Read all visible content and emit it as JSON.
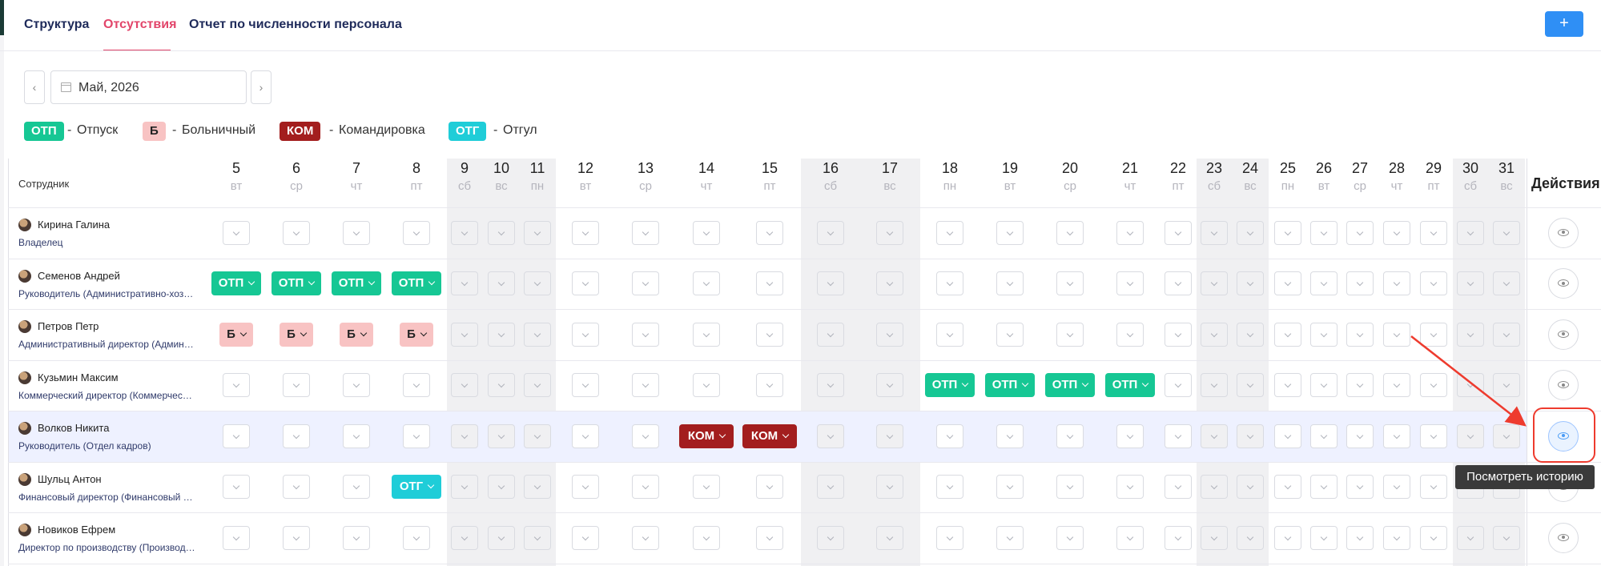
{
  "tabs": [
    {
      "label": "Структура",
      "active": false
    },
    {
      "label": "Отсутствия",
      "active": true
    },
    {
      "label": "Отчет по численности персонала",
      "active": false
    }
  ],
  "add_button": {
    "label": "+"
  },
  "month_picker": {
    "value": "Май, 2026",
    "prev": "‹",
    "next": "›"
  },
  "legend": [
    {
      "code": "ОТП",
      "label": "Отпуск",
      "kind": "otp"
    },
    {
      "code": "Б",
      "label": "Больничный",
      "kind": "b"
    },
    {
      "code": "КОМ",
      "label": "Командировка",
      "kind": "kom"
    },
    {
      "code": "ОТГ",
      "label": "Отгул",
      "kind": "otg"
    }
  ],
  "legend_separator": "-",
  "columns": {
    "employee": "Сотрудник",
    "actions": "Действия"
  },
  "days": [
    {
      "d": "5",
      "w": "вт",
      "weekend": false
    },
    {
      "d": "6",
      "w": "ср",
      "weekend": false
    },
    {
      "d": "7",
      "w": "чт",
      "weekend": false
    },
    {
      "d": "8",
      "w": "пт",
      "weekend": false
    },
    {
      "d": "9",
      "w": "сб",
      "weekend": true
    },
    {
      "d": "10",
      "w": "вс",
      "weekend": true
    },
    {
      "d": "11",
      "w": "пн",
      "weekend": true
    },
    {
      "d": "12",
      "w": "вт",
      "weekend": false
    },
    {
      "d": "13",
      "w": "ср",
      "weekend": false
    },
    {
      "d": "14",
      "w": "чт",
      "weekend": false
    },
    {
      "d": "15",
      "w": "пт",
      "weekend": false
    },
    {
      "d": "16",
      "w": "сб",
      "weekend": true
    },
    {
      "d": "17",
      "w": "вс",
      "weekend": true
    },
    {
      "d": "18",
      "w": "пн",
      "weekend": false
    },
    {
      "d": "19",
      "w": "вт",
      "weekend": false
    },
    {
      "d": "20",
      "w": "ср",
      "weekend": false
    },
    {
      "d": "21",
      "w": "чт",
      "weekend": false
    },
    {
      "d": "22",
      "w": "пт",
      "weekend": false
    },
    {
      "d": "23",
      "w": "сб",
      "weekend": true
    },
    {
      "d": "24",
      "w": "вс",
      "weekend": true
    },
    {
      "d": "25",
      "w": "пн",
      "weekend": false
    },
    {
      "d": "26",
      "w": "вт",
      "weekend": false
    },
    {
      "d": "27",
      "w": "ср",
      "weekend": false
    },
    {
      "d": "28",
      "w": "чт",
      "weekend": false
    },
    {
      "d": "29",
      "w": "пт",
      "weekend": false
    },
    {
      "d": "30",
      "w": "сб",
      "weekend": true
    },
    {
      "d": "31",
      "w": "вс",
      "weekend": true
    }
  ],
  "employees": [
    {
      "name": "Кирина Галина",
      "role": "Владелец",
      "absences": {}
    },
    {
      "name": "Семенов Андрей",
      "role": "Руководитель (Административно-хоз…",
      "absences": {
        "5": "ОТП",
        "6": "ОТП",
        "7": "ОТП",
        "8": "ОТП"
      }
    },
    {
      "name": "Петров Петр",
      "role": "Административный директор (Админ…",
      "absences": {
        "5": "Б",
        "6": "Б",
        "7": "Б",
        "8": "Б"
      }
    },
    {
      "name": "Кузьмин Максим",
      "role": "Коммерческий директор (Коммерчес…",
      "absences": {
        "18": "ОТП",
        "19": "ОТП",
        "20": "ОТП",
        "21": "ОТП"
      }
    },
    {
      "name": "Волков Никита",
      "role": "Руководитель (Отдел кадров)",
      "absences": {
        "14": "КОМ",
        "15": "КОМ"
      },
      "highlighted": true
    },
    {
      "name": "Шульц Антон",
      "role": "Финансовый директор (Финансовый …",
      "absences": {
        "8": "ОТГ"
      }
    },
    {
      "name": "Новиков Ефрем",
      "role": "Директор по производству (Производ…",
      "absences": {}
    }
  ],
  "tooltip": "Посмотреть историю",
  "colors": {
    "otp": "#16c794",
    "b": "#f8c3c3",
    "kom": "#a31e1e",
    "otg": "#1fcdd8",
    "accent": "#e2456a",
    "primary": "#2f8ff5"
  },
  "icons": {
    "actions": "eye-icon",
    "calendar": "calendar-icon",
    "dropdown": "chevron-down-icon"
  }
}
